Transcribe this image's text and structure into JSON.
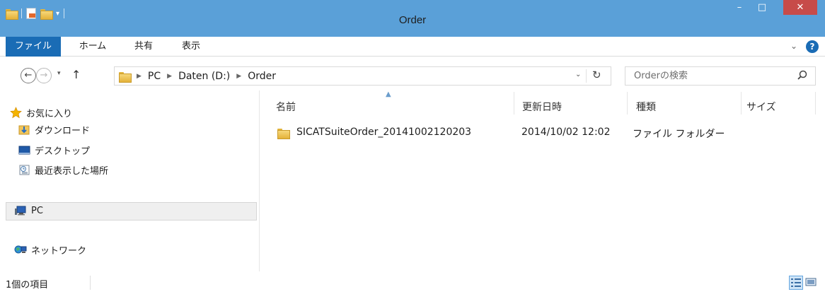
{
  "window": {
    "title": "Order"
  },
  "quick_access": {
    "icons": [
      "folder-icon",
      "properties-icon",
      "new-folder-icon"
    ],
    "customize_glyph": "▾"
  },
  "window_controls": {
    "minimize": "–",
    "maximize": "□",
    "close": "✕"
  },
  "ribbon": {
    "tabs": [
      {
        "label": "ファイル",
        "active": true
      },
      {
        "label": "ホーム"
      },
      {
        "label": "共有"
      },
      {
        "label": "表示"
      }
    ],
    "expand_glyph": "⌄",
    "help_glyph": "?"
  },
  "navigation": {
    "back_glyph": "←",
    "forward_glyph": "→",
    "recent_glyph": "▾",
    "up_glyph": "↑"
  },
  "address": {
    "crumbs": [
      "PC",
      "Daten (D:)",
      "Order"
    ],
    "sep_glyph": "▶",
    "dropdown_glyph": "⌄",
    "refresh_glyph": "↻"
  },
  "search": {
    "placeholder": "Orderの検索"
  },
  "nav_pane": {
    "favorites_label": "お気に入り",
    "favorites": [
      "ダウンロード",
      "デスクトップ",
      "最近表示した場所"
    ],
    "pc_label": "PC",
    "network_label": "ネットワーク"
  },
  "columns": {
    "name": "名前",
    "modified": "更新日時",
    "type": "種類",
    "size": "サイズ",
    "sort_glyph": "▲"
  },
  "files": [
    {
      "name": "SICATSuiteOrder_20141002120203",
      "modified": "2014/10/02 12:02",
      "type": "ファイル フォルダー",
      "size": ""
    }
  ],
  "status": {
    "item_count": "1個の項目"
  },
  "colors": {
    "titlebar": "#5aa0d8",
    "file_tab": "#1a6cb5",
    "close_button": "#c74b49",
    "selection": "#efefef"
  }
}
